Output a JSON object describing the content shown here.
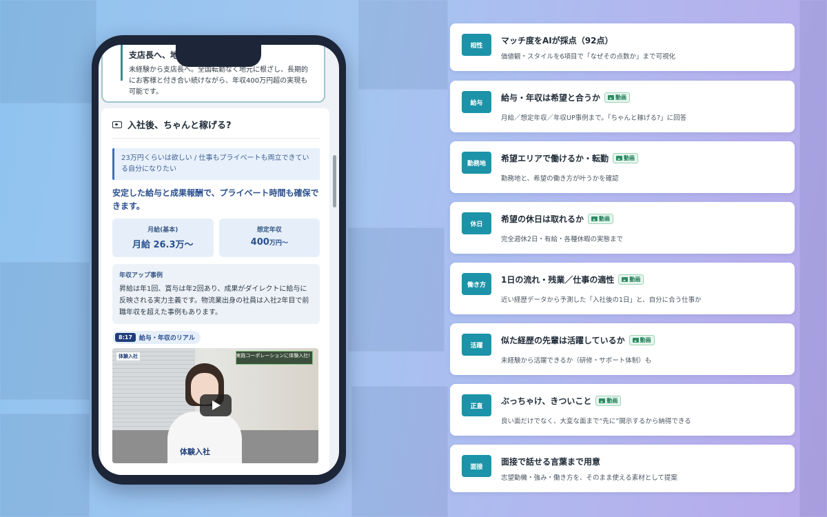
{
  "phone": {
    "top_card": {
      "title": "支店長へ、地元",
      "body": "未経験から支店長へ。全国転勤なく地元に根ざし、長期的にお客様と付き合い続けながら、年収400万円超の実現も可能です。"
    },
    "section": {
      "title": "入社後、ちゃんと稼げる?",
      "quote": "23万円くらいは欲しい / 仕事もプライベートも両立できている自分になりたい",
      "lead": "安定した給与と成果報酬で、プライベート時間も確保できます。",
      "stats": [
        {
          "label": "月給(基本)",
          "value": "月給 26.3万〜",
          "unit": ""
        },
        {
          "label": "想定年収",
          "value": "400",
          "unit": "万円〜"
        }
      ],
      "example": {
        "label": "年収アップ事例",
        "body": "昇給は年1回、賞与は年2回あり、成果がダイレクトに給与に反映される実力主義です。物流業出身の社員は入社2年目で前職年収を超えた事例もあります。"
      },
      "video": {
        "time": "8:17",
        "title": "給与・年収のリアル",
        "banner_text": "実践コーポレーションに体験入社!",
        "logo_text": "体験入社",
        "hoodie_text": "体験入社"
      }
    }
  },
  "video_chip_label": "動画",
  "features": [
    {
      "badge": "相性",
      "title": "マッチ度をAIが採点（92点）",
      "desc": "価値観・スタイルを6項目で「なぜその点数か」まで可視化",
      "video": false
    },
    {
      "badge": "給与",
      "title": "給与・年収は希望と合うか",
      "desc": "月給／想定年収／年収UP事例まで。「ちゃんと稼げる?」に回答",
      "video": true
    },
    {
      "badge": "勤務地",
      "title": "希望エリアで働けるか・転勤",
      "desc": "勤務地と、希望の働き方が叶うかを確認",
      "video": true
    },
    {
      "badge": "休日",
      "title": "希望の休日は取れるか",
      "desc": "完全週休2日・有給・各種休暇の実態まで",
      "video": true
    },
    {
      "badge": "働き方",
      "title": "1日の流れ・残業／仕事の適性",
      "desc": "近い経歴データから予測した「入社後の1日」と、自分に合う仕事か",
      "video": true
    },
    {
      "badge": "活躍",
      "title": "似た経歴の先輩は活躍しているか",
      "desc": "未経験から活躍できるか（研修・サポート体制）も",
      "video": true
    },
    {
      "badge": "正直",
      "title": "ぶっちゃけ、きついこと",
      "desc": "良い面だけでなく、大変な面まで“先に”開示するから納得できる",
      "video": true
    },
    {
      "badge": "面接",
      "title": "面接で話せる言葉まで用意",
      "desc": "志望動機・強み・働き方を、そのまま使える素材として提案",
      "video": false
    }
  ]
}
